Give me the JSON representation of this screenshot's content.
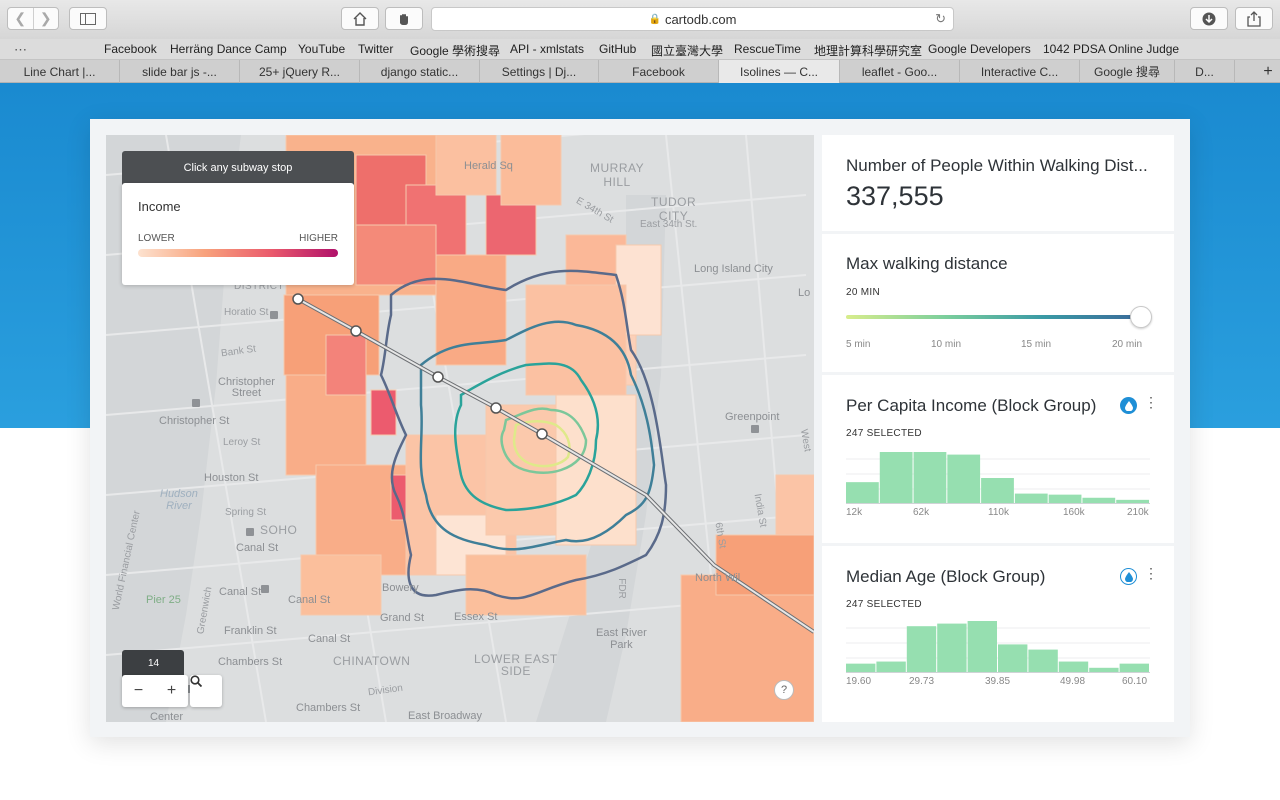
{
  "browser": {
    "url": "cartodb.com",
    "bookmarks": [
      "Facebook",
      "Herräng Dance Camp",
      "YouTube",
      "Twitter",
      "Google 學術搜尋",
      "API - xmlstats",
      "GitHub",
      "國立臺灣大學",
      "RescueTime",
      "地理計算科學研究室",
      "Google Developers",
      "1042 PDSA Online Judge"
    ],
    "tabs": [
      {
        "label": "Line Chart |...",
        "active": false
      },
      {
        "label": "slide bar js -...",
        "active": false
      },
      {
        "label": "25+ jQuery R...",
        "active": false
      },
      {
        "label": "django static...",
        "active": false
      },
      {
        "label": "Settings | Dj...",
        "active": false
      },
      {
        "label": "Facebook",
        "active": false
      },
      {
        "label": "Isolines — C...",
        "active": true
      },
      {
        "label": "leaflet - Goo...",
        "active": false
      },
      {
        "label": "Interactive C...",
        "active": false
      },
      {
        "label": "Google 搜尋",
        "active": false
      },
      {
        "label": "D...",
        "active": false
      }
    ]
  },
  "map": {
    "hint": "Click any subway stop",
    "legend": {
      "title": "Income",
      "low": "LOWER",
      "high": "HIGHER"
    },
    "zoom_level": "14",
    "help": "?",
    "labels": {
      "murray_hill": "MURRAY\nHILL",
      "tudor_city": "TUDOR\nCITY",
      "herald_sq": "Herald Sq",
      "e34": "E 34th St",
      "east34": "East 34th St.",
      "lic": "Long Island City",
      "lo": "Lo",
      "horatio": "Horatio St",
      "bank": "Bank St",
      "christopher_street": "Christopher\nStreet",
      "christopher_st": "Christopher St",
      "leroy": "Leroy St",
      "houston": "Houston St",
      "hudson": "Hudson\nRiver",
      "spring": "Spring St",
      "soho": "SOHO",
      "canal1": "Canal St",
      "canal2": "Canal St",
      "canal3": "Canal St",
      "canal4": "Canal St",
      "franklin": "Franklin St",
      "pier25": "Pier 25",
      "wfc": "World Financial Center",
      "chambers1": "Chambers St",
      "chambers2": "Chambers St",
      "chinatown": "CHINATOWN",
      "les": "LOWER EAST\nSIDE",
      "bowery": "Bowery",
      "grand": "Grand St",
      "essex": "Essex St",
      "east_broadway": "East Broadway",
      "division": "Division",
      "erp": "East River\nPark",
      "north_wil": "North Wil",
      "greenpoint": "Greenpoint",
      "india": "India St",
      "sixth": "6th St",
      "west": "West",
      "greenwich": "Greenwich",
      "fdr": "FDR",
      "district": "DISTRICT",
      "center": "Center"
    }
  },
  "widgets": {
    "people": {
      "title": "Number of People Within Walking Dist...",
      "value": "337,555"
    },
    "walking": {
      "title": "Max walking distance",
      "subtitle": "20 MIN",
      "ticks": [
        "5 min",
        "10 min",
        "15 min",
        "20 min"
      ],
      "value_min": 20
    },
    "income": {
      "title": "Per Capita Income (Block Group)",
      "selected": "247 SELECTED",
      "ticks": [
        "12k",
        "62k",
        "110k",
        "160k",
        "210k"
      ],
      "bars": [
        0.42,
        1.0,
        1.0,
        0.95,
        0.5,
        0.2,
        0.18,
        0.12,
        0.08
      ],
      "accent": "#1f8fd6"
    },
    "age": {
      "title": "Median Age (Block Group)",
      "selected": "247 SELECTED",
      "ticks": [
        "19.60",
        "29.73",
        "39.85",
        "49.98",
        "60.10"
      ],
      "bars": [
        0.18,
        0.22,
        0.9,
        0.95,
        1.0,
        0.55,
        0.45,
        0.22,
        0.1,
        0.18
      ],
      "accent": "#1f8fd6"
    }
  },
  "colors": {
    "bar": "#96dfb0",
    "browser_blue": "#2196d8"
  }
}
